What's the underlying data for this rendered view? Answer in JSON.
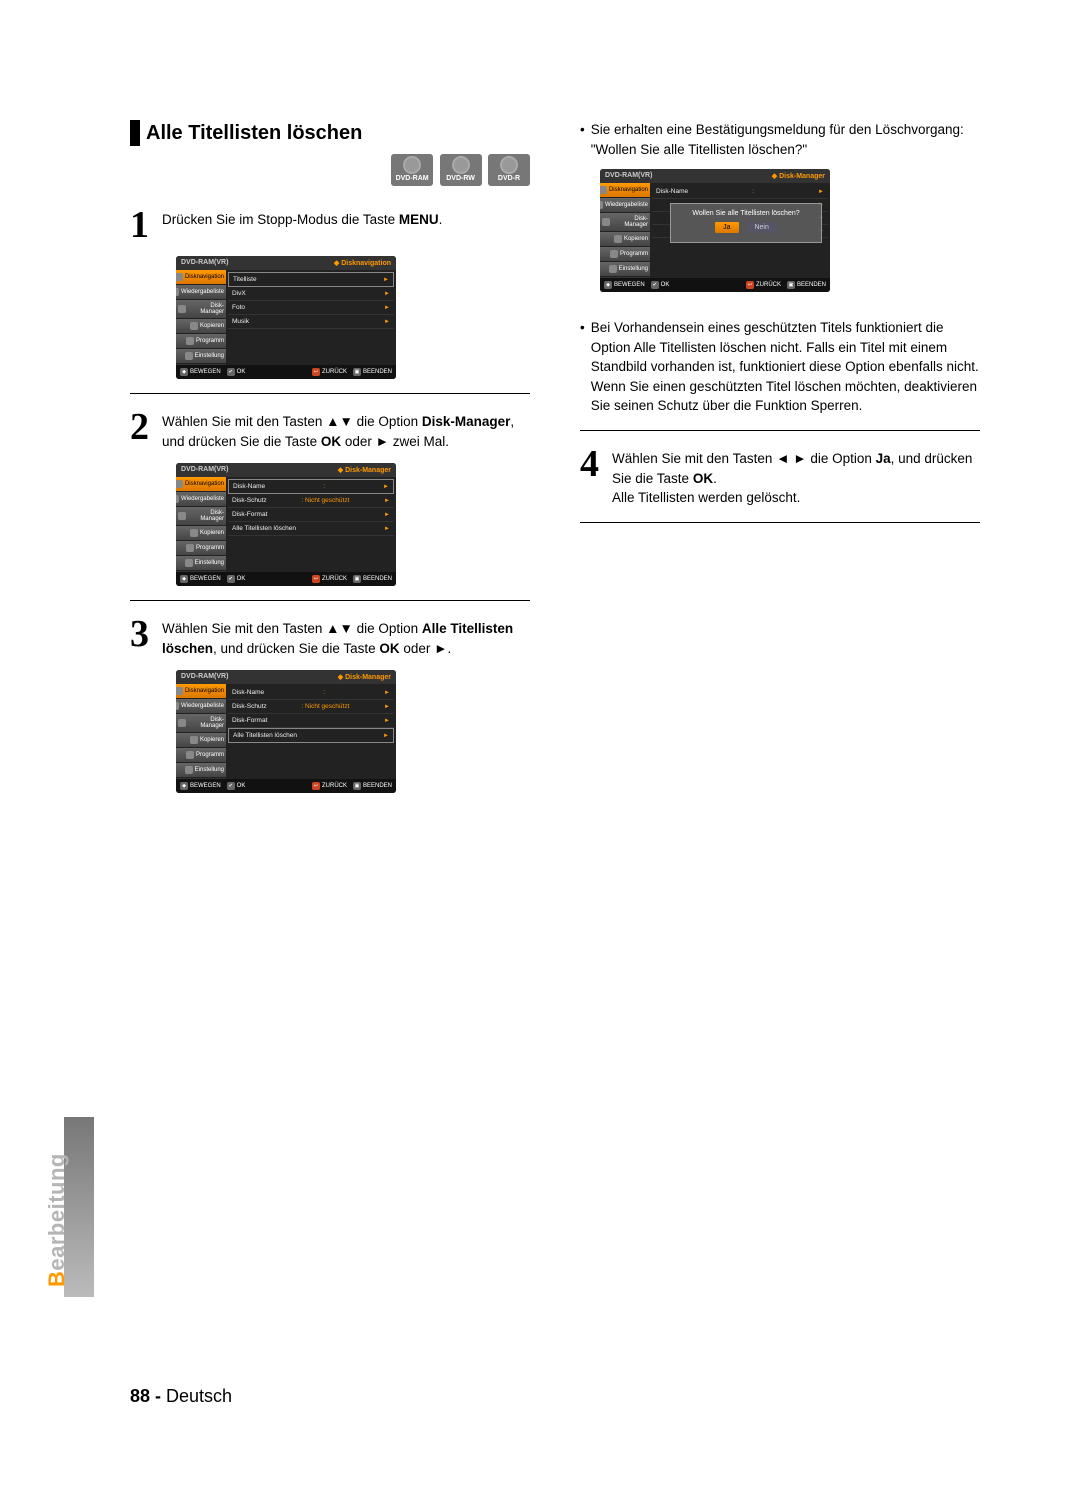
{
  "section_title": "Alle Titellisten löschen",
  "disc_labels": [
    "DVD-RAM",
    "DVD-RW",
    "DVD-R"
  ],
  "steps": {
    "s1": {
      "num": "1",
      "pre": "Drücken Sie im Stopp-Modus die Taste ",
      "b1": "MENU",
      "post": "."
    },
    "s2": {
      "num": "2",
      "pre": "Wählen Sie mit den Tasten ▲▼ die Option ",
      "b1": "Disk-Manager",
      "mid": ", und drücken Sie die Taste ",
      "b2": "OK",
      "mid2": " oder ",
      "sym": "►",
      "post": " zwei Mal."
    },
    "s3": {
      "num": "3",
      "pre": "Wählen Sie mit den Tasten ▲▼ die Option ",
      "b1": "Alle Titellisten löschen",
      "mid": ", und drücken Sie die Taste ",
      "b2": "OK",
      "mid2": " oder ",
      "sym": "►",
      "post": "."
    },
    "s4": {
      "num": "4",
      "pre": "Wählen Sie mit den Tasten ◄ ► die Option ",
      "b1": "Ja",
      "mid": ", und drücken Sie die Taste ",
      "b2": "OK",
      "post": ".",
      "line2": "Alle Titellisten werden gelöscht."
    }
  },
  "bullets": {
    "b1": "Sie erhalten eine Bestätigungsmeldung für den Löschvorgang: \"Wollen Sie alle Titellisten löschen?\"",
    "b2": "Bei Vorhandensein eines geschützten Titels funktioniert die Option Alle Titellisten löschen nicht. Falls ein Titel mit einem Standbild vorhanden ist, funktioniert diese Option ebenfalls nicht.\nWenn Sie einen geschützten Titel löschen möchten, deaktivieren Sie seinen Schutz über die Funktion Sperren."
  },
  "screens": {
    "common": {
      "header_left": "DVD-RAM(VR)",
      "sidebar": [
        "Disknavigation",
        "Wiedergabeliste",
        "Disk-Manager",
        "Kopieren",
        "Programm",
        "Einstellung"
      ],
      "footbar": {
        "move": "BEWEGEN",
        "ok": "OK",
        "back": "ZURÜCK",
        "exit": "BEENDEN"
      }
    },
    "sc1": {
      "header_right": "Disknavigation",
      "rows": [
        {
          "label": "Titelliste"
        },
        {
          "label": "DivX"
        },
        {
          "label": "Foto"
        },
        {
          "label": "Musik"
        }
      ]
    },
    "sc2": {
      "header_right": "Disk-Manager",
      "rows": [
        {
          "label": "Disk-Name",
          "value": ":"
        },
        {
          "label": "Disk-Schutz",
          "value": ": Nicht geschützt"
        },
        {
          "label": "Disk-Format"
        },
        {
          "label": "Alle Titellisten löschen"
        }
      ]
    },
    "sc3": {
      "header_right": "Disk-Manager",
      "rows": [
        {
          "label": "Disk-Name",
          "value": ":"
        },
        {
          "label": "Disk-Schutz",
          "value": ": Nicht geschützt"
        },
        {
          "label": "Disk-Format"
        },
        {
          "label": "Alle Titellisten löschen",
          "boxed": true
        }
      ]
    },
    "confirm": {
      "header_right": "Disk-Manager",
      "rows_visible": [
        "Disk-Name",
        ":",
        "",
        ""
      ],
      "dialog_text": "Wollen Sie alle Titellisten löschen?",
      "btn_yes": "Ja",
      "btn_no": "Nein"
    }
  },
  "side_tab": {
    "accent": "B",
    "rest": "earbeitung"
  },
  "footer": {
    "page": "88 -",
    "lang": " Deutsch"
  }
}
